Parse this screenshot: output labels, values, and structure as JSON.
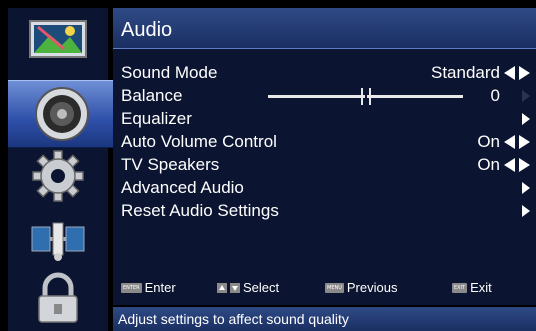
{
  "sidebar": {
    "items": [
      {
        "icon": "picture-icon",
        "active": false
      },
      {
        "icon": "speaker-icon",
        "active": true
      },
      {
        "icon": "gear-icon",
        "active": false
      },
      {
        "icon": "satellite-icon",
        "active": false
      },
      {
        "icon": "lock-icon",
        "active": false
      }
    ]
  },
  "main": {
    "title": "Audio",
    "rows": [
      {
        "label": "Sound Mode",
        "value": "Standard",
        "control": "left-right"
      },
      {
        "label": "Balance",
        "value": "0",
        "control": "slider",
        "level": 0.5
      },
      {
        "label": "Equalizer",
        "control": "submenu"
      },
      {
        "label": "Auto Volume Control",
        "value": "On",
        "control": "left-right"
      },
      {
        "label": "TV Speakers",
        "value": "On",
        "control": "left-right"
      },
      {
        "label": "Advanced Audio",
        "control": "submenu"
      },
      {
        "label": "Reset Audio Settings",
        "control": "submenu"
      }
    ]
  },
  "hints": {
    "enter_key": "ENTER",
    "enter_label": "Enter",
    "select_label": "Select",
    "menu_key": "MENU",
    "previous_label": "Previous",
    "exit_key": "EXIT",
    "exit_label": "Exit"
  },
  "status": {
    "text": "Adjust settings to affect sound quality"
  },
  "colors": {
    "panel": "#0b1430",
    "title_bar": "#2f4a86",
    "active_item": "#3f62bd",
    "text": "#ffffff",
    "key_bg": "#8a8a8a"
  }
}
